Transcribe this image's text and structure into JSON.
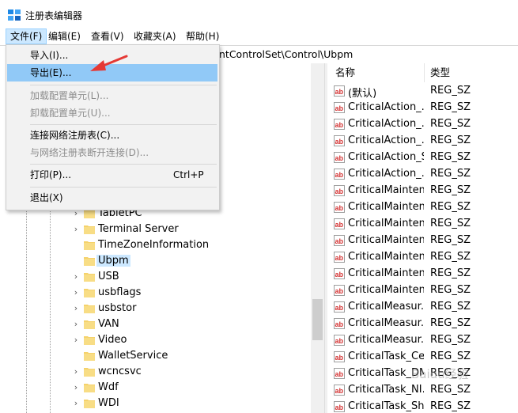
{
  "window": {
    "title": "注册表编辑器"
  },
  "menubar": [
    {
      "label": "文件(F)",
      "active": true
    },
    {
      "label": "编辑(E)"
    },
    {
      "label": "查看(V)"
    },
    {
      "label": "收藏夹(A)"
    },
    {
      "label": "帮助(H)"
    }
  ],
  "address": {
    "path_visible": "ntControlSet\\Control\\Ubpm"
  },
  "file_menu": {
    "items": [
      {
        "label": "导入(I)...",
        "disabled": false,
        "highlighted": false
      },
      {
        "label": "导出(E)...",
        "disabled": false,
        "highlighted": true
      },
      {
        "label": "加载配置单元(L)...",
        "disabled": true
      },
      {
        "label": "卸载配置单元(U)...",
        "disabled": true
      },
      {
        "label": "连接网络注册表(C)...",
        "disabled": false
      },
      {
        "label": "与网络注册表断开连接(D)...",
        "disabled": true
      },
      {
        "label": "打印(P)...",
        "disabled": false,
        "shortcut": "Ctrl+P"
      },
      {
        "label": "退出(X)",
        "disabled": false
      }
    ]
  },
  "tree": {
    "items": [
      {
        "label": "TabletPC",
        "expandable": true
      },
      {
        "label": "Terminal Server",
        "expandable": true
      },
      {
        "label": "TimeZoneInformation",
        "expandable": false
      },
      {
        "label": "Ubpm",
        "expandable": false,
        "selected": true
      },
      {
        "label": "USB",
        "expandable": true
      },
      {
        "label": "usbflags",
        "expandable": true
      },
      {
        "label": "usbstor",
        "expandable": true
      },
      {
        "label": "VAN",
        "expandable": true
      },
      {
        "label": "Video",
        "expandable": true
      },
      {
        "label": "WalletService",
        "expandable": false
      },
      {
        "label": "wcncsvc",
        "expandable": true
      },
      {
        "label": "Wdf",
        "expandable": true
      },
      {
        "label": "WDI",
        "expandable": true
      }
    ]
  },
  "values_list": {
    "columns": [
      "名称",
      "类型"
    ],
    "rows": [
      {
        "name": "(默认)",
        "type": "REG_SZ"
      },
      {
        "name": "CriticalAction_...",
        "type": "REG_SZ"
      },
      {
        "name": "CriticalAction_...",
        "type": "REG_SZ"
      },
      {
        "name": "CriticalAction_...",
        "type": "REG_SZ"
      },
      {
        "name": "CriticalAction_S...",
        "type": "REG_SZ"
      },
      {
        "name": "CriticalAction_...",
        "type": "REG_SZ"
      },
      {
        "name": "CriticalMainten...",
        "type": "REG_SZ"
      },
      {
        "name": "CriticalMainten...",
        "type": "REG_SZ"
      },
      {
        "name": "CriticalMainten...",
        "type": "REG_SZ"
      },
      {
        "name": "CriticalMainten...",
        "type": "REG_SZ"
      },
      {
        "name": "CriticalMainten...",
        "type": "REG_SZ"
      },
      {
        "name": "CriticalMainten...",
        "type": "REG_SZ"
      },
      {
        "name": "CriticalMainten...",
        "type": "REG_SZ"
      },
      {
        "name": "CriticalMeasur...",
        "type": "REG_SZ"
      },
      {
        "name": "CriticalMeasur...",
        "type": "REG_SZ"
      },
      {
        "name": "CriticalMeasur...",
        "type": "REG_SZ"
      },
      {
        "name": "CriticalTask_Ce...",
        "type": "REG_SZ"
      },
      {
        "name": "CriticalTask_DM...",
        "type": "REG_SZ"
      },
      {
        "name": "CriticalTask_NI...",
        "type": "REG_SZ"
      },
      {
        "name": "CriticalTask_Sh...",
        "type": "REG_SZ"
      }
    ]
  },
  "watermark": "Baidu经验",
  "colors": {
    "menu_highlight": "#91c9f7",
    "selection": "#cce8ff",
    "folder": "#f5d26b",
    "arrow": "#e53935"
  }
}
